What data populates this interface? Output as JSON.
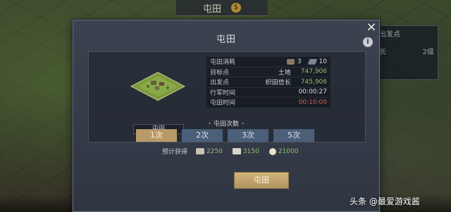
{
  "map": {
    "top_title": "屯田",
    "top_coin": "$"
  },
  "side_panel": {
    "title": "出发点",
    "line1": "长",
    "line2": "2级"
  },
  "modal": {
    "title": "屯田",
    "close_icon": "×",
    "info_icon": "i"
  },
  "tile": {
    "label": "屯田"
  },
  "info_rows": [
    {
      "label": "屯田消耗",
      "cost1": "3",
      "cost2": "10"
    },
    {
      "label": "目标点",
      "type": "土地",
      "value": "747,906"
    },
    {
      "label": "出发点",
      "type": "织田信长",
      "value": "745,906"
    },
    {
      "label": "行军时间",
      "value": "00:00:27"
    },
    {
      "label": "屯田时间",
      "value": "00:10:00"
    }
  ],
  "count": {
    "title": "屯田次数",
    "options": [
      "1次",
      "2次",
      "3次",
      "5次"
    ],
    "selected_index": 0
  },
  "reward": {
    "label": "预计获得",
    "items": [
      {
        "icon": "wood-icon",
        "value": "2250"
      },
      {
        "icon": "iron-icon",
        "value": "3150"
      },
      {
        "icon": "grain-icon",
        "value": "21000"
      }
    ]
  },
  "confirm_label": "屯田",
  "watermark": "头条 @最爱游戏酱",
  "colors": {
    "green": "#8fc06a",
    "red": "#d65a4f",
    "active_btn": "#b89a68",
    "btn": "#4b5f79"
  }
}
